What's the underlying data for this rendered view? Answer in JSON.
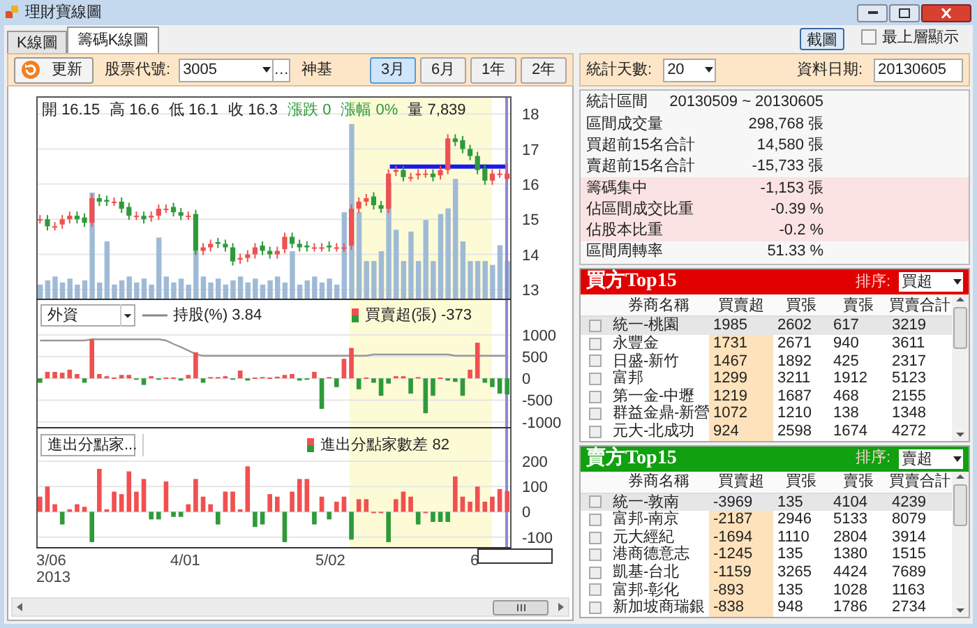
{
  "window": {
    "title": "理財寶線圖"
  },
  "tabs": [
    {
      "label": "K線圖",
      "selected": false
    },
    {
      "label": "籌碼K線圖",
      "selected": true
    }
  ],
  "screenshot_button": "截圖",
  "always_on_top": {
    "label": "最上層顯示",
    "checked": false
  },
  "toolbar": {
    "refresh": "更新",
    "code_label": "股票代號:",
    "code_value": "3005",
    "more": "…",
    "stock_name": "神基",
    "periods": [
      {
        "label": "3月",
        "selected": true
      },
      {
        "label": "6月",
        "selected": false
      },
      {
        "label": "1年",
        "selected": false
      },
      {
        "label": "2年",
        "selected": false
      }
    ]
  },
  "stats_toolbar": {
    "days_label": "統計天數:",
    "days_value": "20",
    "date_label": "資料日期:",
    "date_value": "20130605"
  },
  "chart": {
    "quote": [
      {
        "label": "開",
        "value": "16.15",
        "kind": "price"
      },
      {
        "label": "高",
        "value": "16.6",
        "kind": "price"
      },
      {
        "label": "低",
        "value": "16.1",
        "kind": "price"
      },
      {
        "label": "收",
        "value": "16.3",
        "kind": "price"
      },
      {
        "label": "漲跌",
        "value": "0",
        "kind": "change"
      },
      {
        "label": "漲幅",
        "value": "0%",
        "kind": "change"
      },
      {
        "label": "量",
        "value": "7,839",
        "kind": "price"
      }
    ],
    "price": {
      "chart_data": {
        "type": "candlestick",
        "colors": [
          "#f05050",
          "#2f9a3a",
          "#f05050",
          "#f05050",
          "#f05050",
          "#2f9a3a",
          "#2f9a3a",
          "#f05050",
          "#2f9a3a",
          "#2f9a3a",
          "#f05050",
          "#2f9a3a",
          "#2f9a3a",
          "#f05050",
          "#2f9a3a",
          "#f05050",
          "#f05050",
          "#f05050",
          "#2f9a3a",
          "#2f9a3a",
          "#f05050",
          "#2f9a3a",
          "#f05050",
          "#f05050",
          "#2f9a3a",
          "#2f9a3a",
          "#2f9a3a",
          "#f05050",
          "#f05050",
          "#f05050",
          "#2f9a3a",
          "#2f9a3a",
          "#f05050",
          "#f05050",
          "#2f9a3a",
          "#2f9a3a",
          "#2f9a3a",
          "#f05050",
          "#f05050",
          "#2f9a3a",
          "#f05050",
          "#f05050",
          "#f05050",
          "#f05050",
          "#f05050",
          "#2f9a3a",
          "#2f9a3a",
          "#f05050",
          "#f05050",
          "#2f9a3a",
          "#f05050",
          "#f05050",
          "#f05050",
          "#2f9a3a",
          "#f05050",
          "#f05050",
          "#2f9a3a",
          "#2f9a3a",
          "#2f9a3a",
          "#2f9a3a",
          "#2f9a3a",
          "#f05050",
          "#f05050",
          "#f05050"
        ],
        "ylim": [
          12.7,
          18.5
        ],
        "series": [
          {
            "type": "bar",
            "color": "#9fbad6",
            "values": [
              13.14,
              13.26,
              13.37,
              13.2,
              13.31,
              13.14,
              13.26,
              15.76,
              13.2,
              14.37,
              13.14,
              13.26,
              13.37,
              13.2,
              13.31,
              13.14,
              14.48,
              13.37,
              13.2,
              13.31,
              13.14,
              14.09,
              13.37,
              13.2,
              13.31,
              13.14,
              13.26,
              13.37,
              13.2,
              13.31,
              13.14,
              13.26,
              13.37,
              13.2,
              14.09,
              13.14,
              13.26,
              13.37,
              13.2,
              13.31,
              13.14,
              15.2,
              17.71,
              15.2,
              13.81,
              13.81,
              14.09,
              16.04,
              14.7,
              13.81,
              14.65,
              13.81,
              14.98,
              13.81,
              15.15,
              15.31,
              16.15,
              14.37,
              13.81,
              13.81,
              13.81,
              13.7,
              14.26,
              13.81
            ]
          }
        ],
        "grid": true,
        "ref_lines": [
          {
            "axis": "y",
            "value": 16.5
          }
        ],
        "yticks": [
          18,
          17,
          16,
          15,
          14,
          13
        ],
        "ohlc": [
          [
            15.0,
            15.12,
            14.88,
            15.0
          ],
          [
            15.0,
            15.12,
            14.68,
            14.8
          ],
          [
            14.8,
            14.92,
            14.68,
            14.8
          ],
          [
            14.85,
            15.12,
            14.73,
            15.0
          ],
          [
            15.0,
            15.22,
            14.88,
            15.1
          ],
          [
            15.1,
            15.22,
            14.88,
            15.0
          ],
          [
            15.05,
            15.17,
            14.78,
            14.9
          ],
          [
            14.9,
            15.72,
            14.78,
            15.6
          ],
          [
            15.6,
            15.72,
            15.38,
            15.5
          ],
          [
            15.55,
            15.67,
            15.38,
            15.5
          ],
          [
            15.5,
            15.62,
            15.38,
            15.5
          ],
          [
            15.5,
            15.62,
            15.18,
            15.3
          ],
          [
            15.35,
            15.47,
            14.98,
            15.1
          ],
          [
            15.1,
            15.22,
            14.98,
            15.1
          ],
          [
            15.1,
            15.22,
            14.88,
            15.0
          ],
          [
            15.05,
            15.22,
            14.93,
            15.1
          ],
          [
            15.1,
            15.42,
            14.98,
            15.3
          ],
          [
            15.3,
            15.42,
            15.18,
            15.3
          ],
          [
            15.35,
            15.47,
            15.08,
            15.2
          ],
          [
            15.2,
            15.32,
            14.98,
            15.1
          ],
          [
            15.1,
            15.22,
            14.98,
            15.1
          ],
          [
            15.15,
            15.27,
            13.98,
            14.1
          ],
          [
            14.1,
            14.32,
            13.98,
            14.2
          ],
          [
            14.2,
            14.42,
            14.08,
            14.3
          ],
          [
            14.35,
            14.47,
            14.18,
            14.3
          ],
          [
            14.3,
            14.42,
            14.08,
            14.2
          ],
          [
            14.2,
            14.32,
            13.68,
            13.8
          ],
          [
            13.85,
            14.02,
            13.73,
            13.9
          ],
          [
            13.9,
            14.12,
            13.78,
            14.0
          ],
          [
            14.0,
            14.32,
            13.88,
            14.2
          ],
          [
            14.25,
            14.37,
            13.98,
            14.1
          ],
          [
            14.1,
            14.22,
            13.88,
            14.0
          ],
          [
            14.0,
            14.22,
            13.88,
            14.1
          ],
          [
            14.15,
            14.62,
            14.03,
            14.5
          ],
          [
            14.5,
            14.62,
            14.18,
            14.3
          ],
          [
            14.3,
            14.42,
            14.08,
            14.2
          ],
          [
            14.25,
            14.37,
            14.08,
            14.2
          ],
          [
            14.2,
            14.32,
            14.08,
            14.2
          ],
          [
            14.2,
            14.32,
            14.08,
            14.2
          ],
          [
            14.25,
            14.37,
            14.08,
            14.2
          ],
          [
            14.2,
            14.32,
            14.08,
            14.2
          ],
          [
            14.2,
            14.32,
            14.08,
            14.2
          ],
          [
            14.25,
            15.42,
            14.13,
            15.3
          ],
          [
            15.3,
            15.62,
            15.18,
            15.5
          ],
          [
            15.5,
            15.72,
            15.38,
            15.6
          ],
          [
            15.65,
            15.77,
            15.28,
            15.4
          ],
          [
            15.4,
            15.52,
            15.18,
            15.3
          ],
          [
            15.3,
            16.42,
            15.18,
            16.3
          ],
          [
            16.35,
            16.52,
            16.23,
            16.4
          ],
          [
            16.4,
            16.52,
            16.08,
            16.2
          ],
          [
            16.2,
            16.32,
            16.08,
            16.2
          ],
          [
            16.25,
            16.42,
            16.13,
            16.3
          ],
          [
            16.3,
            16.42,
            16.18,
            16.3
          ],
          [
            16.3,
            16.42,
            16.08,
            16.2
          ],
          [
            16.25,
            16.52,
            16.13,
            16.4
          ],
          [
            16.4,
            17.42,
            16.28,
            17.3
          ],
          [
            17.3,
            17.42,
            17.08,
            17.2
          ],
          [
            17.25,
            17.37,
            16.88,
            17.0
          ],
          [
            17.0,
            17.12,
            16.68,
            16.8
          ],
          [
            16.8,
            16.92,
            16.28,
            16.4
          ],
          [
            16.45,
            16.57,
            15.98,
            16.1
          ],
          [
            16.1,
            16.42,
            15.98,
            16.3
          ],
          [
            16.3,
            16.42,
            16.18,
            16.3
          ],
          [
            16.15,
            16.6,
            16.1,
            16.3
          ]
        ]
      }
    },
    "foreign": {
      "selector": "外資",
      "holding_label": "持股(%)",
      "holding_value": "3.84",
      "net_label": "買賣超(張)",
      "net_value": "-373",
      "chart_data": {
        "type": "bar",
        "colors": [
          "#2f9a3a",
          "#f05050",
          "#f05050",
          "#f05050",
          "#f05050",
          "#f05050",
          "#2f9a3a",
          "#f05050",
          "#f05050",
          "#f05050",
          "#f05050",
          "#f05050",
          "#f05050",
          "#2f9a3a",
          "#2f9a3a",
          "#f05050",
          "#2f9a3a",
          "#f05050",
          "#f05050",
          "#2f9a3a",
          "#f05050",
          "#f05050",
          "#2f9a3a",
          "#f05050",
          "#f05050",
          "#f05050",
          "#2f9a3a",
          "#f05050",
          "#2f9a3a",
          "#f05050",
          "#f05050",
          "#f05050",
          "#f05050",
          "#f05050",
          "#f05050",
          "#2f9a3a",
          "#2f9a3a",
          "#f05050",
          "#2f9a3a",
          "#f05050",
          "#2f9a3a",
          "#f05050",
          "#f05050",
          "#2f9a3a",
          "#f05050",
          "#2f9a3a",
          "#2f9a3a",
          "#2f9a3a",
          "#f05050",
          "#f05050",
          "#2f9a3a",
          "#f05050",
          "#2f9a3a",
          "#2f9a3a",
          "#f05050",
          "#2f9a3a",
          "#2f9a3a",
          "#2f9a3a",
          "#f05050",
          "#f05050",
          "#2f9a3a",
          "#2f9a3a",
          "#2f9a3a",
          "#2f9a3a"
        ],
        "ylim": [
          -1150,
          1800
        ],
        "series": [
          {
            "type": "line",
            "color": "#999999",
            "values": [
              870,
              870,
              870,
              870,
              870,
              870,
              870,
              900,
              900,
              900,
              900,
              900,
              900,
              900,
              900,
              900,
              900,
              870,
              790,
              720,
              640,
              560,
              520,
              520,
              520,
              520,
              520,
              520,
              520,
              520,
              520,
              520,
              520,
              520,
              520,
              520,
              520,
              520,
              520,
              520,
              520,
              520,
              520,
              520,
              520,
              550,
              550,
              550,
              550,
              550,
              550,
              550,
              550,
              550,
              550,
              550,
              520,
              520,
              520,
              520,
              520,
              520,
              520,
              520
            ]
          }
        ],
        "grid": true,
        "yticks": [
          1000,
          500,
          0,
          -500,
          -1000
        ],
        "values": [
          -100,
          150,
          150,
          130,
          200,
          100,
          -100,
          900,
          100,
          50,
          20,
          80,
          80,
          -20,
          -150,
          50,
          -20,
          20,
          20,
          -50,
          80,
          600,
          -100,
          30,
          30,
          50,
          -20,
          180,
          -50,
          20,
          30,
          20,
          40,
          80,
          100,
          -50,
          -30,
          150,
          -700,
          30,
          -200,
          450,
          700,
          -250,
          20,
          -100,
          -400,
          -120,
          50,
          50,
          -350,
          30,
          -800,
          -400,
          20,
          -50,
          -80,
          -400,
          200,
          820,
          -100,
          -200,
          -350,
          -370
        ]
      }
    },
    "branch": {
      "selector": "進出分點家...",
      "diff_label": "進出分點家數差",
      "diff_value": "82",
      "chart_data": {
        "type": "bar",
        "colors": [
          "#f05050",
          "#f05050",
          "#f05050",
          "#2f9a3a",
          "#f05050",
          "#f05050",
          "#f05050",
          "#2f9a3a",
          "#f05050",
          "#f05050",
          "#f05050",
          "#f05050",
          "#f05050",
          "#f05050",
          "#f05050",
          "#2f9a3a",
          "#2f9a3a",
          "#f05050",
          "#2f9a3a",
          "#2f9a3a",
          "#f05050",
          "#f05050",
          "#f05050",
          "#f05050",
          "#2f9a3a",
          "#f05050",
          "#f05050",
          "#f05050",
          "#f05050",
          "#2f9a3a",
          "#2f9a3a",
          "#f05050",
          "#f05050",
          "#2f9a3a",
          "#f05050",
          "#f05050",
          "#f05050",
          "#2f9a3a",
          "#f05050",
          "#2f9a3a",
          "#f05050",
          "#f05050",
          "#2f9a3a",
          "#f05050",
          "#f05050",
          "#f05050",
          "#f05050",
          "#2f9a3a",
          "#f05050",
          "#f05050",
          "#f05050",
          "#2f9a3a",
          "#f05050",
          "#2f9a3a",
          "#2f9a3a",
          "#2f9a3a",
          "#f05050",
          "#f05050",
          "#f05050",
          "#f05050",
          "#f05050",
          "#f05050",
          "#f05050",
          "#f05050"
        ],
        "ylim": [
          -145,
          330
        ],
        "grid": true,
        "yticks": [
          200,
          100,
          0,
          -100
        ],
        "values": [
          60,
          100,
          30,
          -50,
          10,
          30,
          20,
          -120,
          170,
          10,
          80,
          70,
          160,
          80,
          130,
          -30,
          -30,
          120,
          -20,
          -20,
          30,
          130,
          60,
          30,
          -50,
          80,
          80,
          10,
          180,
          -60,
          -50,
          70,
          60,
          -120,
          80,
          130,
          130,
          -50,
          60,
          -30,
          40,
          60,
          -110,
          50,
          50,
          0,
          0,
          -120,
          50,
          80,
          60,
          -50,
          0,
          -40,
          -40,
          -40,
          140,
          60,
          40,
          100,
          40,
          60,
          90,
          82
        ]
      }
    },
    "dates": [
      {
        "label": "3/06",
        "sub": "2013"
      },
      {
        "label": "4/01"
      },
      {
        "label": "5/02"
      },
      {
        "label": "6"
      }
    ]
  },
  "stats": [
    {
      "label": "統計區間",
      "value": "20130509 ~ 20130605",
      "highlighted": false
    },
    {
      "label": "區間成交量",
      "value": "298,768",
      "unit": "張",
      "highlighted": false
    },
    {
      "label": "買超前15名合計",
      "value": "14,580",
      "unit": "張",
      "highlighted": false
    },
    {
      "label": "賣超前15名合計",
      "value": "-15,733",
      "unit": "張",
      "highlighted": false
    },
    {
      "label": "籌碼集中",
      "value": "-1,153",
      "unit": "張",
      "highlighted": true
    },
    {
      "label": "佔區間成交比重",
      "value": "-0.39",
      "unit": "%",
      "highlighted": true
    },
    {
      "label": "佔股本比重",
      "value": "-0.2",
      "unit": "%",
      "highlighted": true
    },
    {
      "label": "區間周轉率",
      "value": "51.33",
      "unit": "%",
      "highlighted": false
    }
  ],
  "tables": [
    {
      "title": "買方Top15",
      "kind": "buy",
      "sort_label": "排序:",
      "sort_value": "買超",
      "columns": [
        "券商名稱",
        "買賣超",
        "買張",
        "賣張",
        "買賣合計"
      ],
      "rows": [
        {
          "cells": [
            "統一-桃園",
            "1985",
            "2602",
            "617",
            "3219"
          ],
          "selected": true,
          "checked": false
        },
        {
          "cells": [
            "永豐金",
            "1731",
            "2671",
            "940",
            "3611"
          ],
          "selected": false,
          "checked": false
        },
        {
          "cells": [
            "日盛-新竹",
            "1467",
            "1892",
            "425",
            "2317"
          ],
          "selected": false,
          "checked": false
        },
        {
          "cells": [
            "富邦",
            "1299",
            "3211",
            "1912",
            "5123"
          ],
          "selected": false,
          "checked": false
        },
        {
          "cells": [
            "第一金-中壢",
            "1219",
            "1687",
            "468",
            "2155"
          ],
          "selected": false,
          "checked": false
        },
        {
          "cells": [
            "群益金鼎-新營",
            "1072",
            "1210",
            "138",
            "1348"
          ],
          "selected": false,
          "checked": false
        },
        {
          "cells": [
            "元大-北成功",
            "924",
            "2598",
            "1674",
            "4272"
          ],
          "selected": false,
          "checked": false
        }
      ]
    },
    {
      "title": "賣方Top15",
      "kind": "sell",
      "sort_label": "排序:",
      "sort_value": "賣超",
      "columns": [
        "券商名稱",
        "買賣超",
        "買張",
        "賣張",
        "買賣合計"
      ],
      "rows": [
        {
          "cells": [
            "統一-敦南",
            "-3969",
            "135",
            "4104",
            "4239"
          ],
          "selected": true,
          "checked": false
        },
        {
          "cells": [
            "富邦-南京",
            "-2187",
            "2946",
            "5133",
            "8079"
          ],
          "selected": false,
          "checked": false
        },
        {
          "cells": [
            "元大經紀",
            "-1694",
            "1110",
            "2804",
            "3914"
          ],
          "selected": false,
          "checked": false
        },
        {
          "cells": [
            "港商德意志",
            "-1245",
            "135",
            "1380",
            "1515"
          ],
          "selected": false,
          "checked": false
        },
        {
          "cells": [
            "凱基-台北",
            "-1159",
            "3265",
            "4424",
            "7689"
          ],
          "selected": false,
          "checked": false
        },
        {
          "cells": [
            "富邦-彰化",
            "-893",
            "135",
            "1028",
            "1163"
          ],
          "selected": false,
          "checked": false
        },
        {
          "cells": [
            "新加坡商瑞銀",
            "-838",
            "948",
            "1786",
            "2734"
          ],
          "selected": false,
          "checked": false
        }
      ]
    }
  ]
}
